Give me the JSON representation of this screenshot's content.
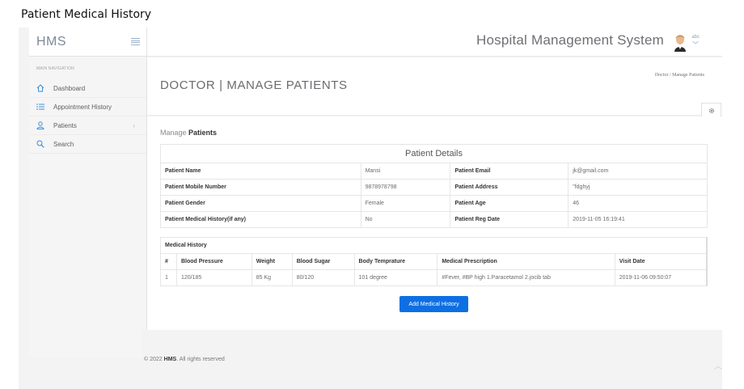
{
  "caption": "Patient Medical History",
  "brand": "HMS",
  "header": {
    "system_title": "Hospital Management System",
    "user_name": "abc",
    "user_caret": "﹀"
  },
  "nav": {
    "heading": "MAIN NAVIGATION",
    "items": [
      {
        "label": "Dashboard",
        "icon": "home-icon"
      },
      {
        "label": "Appointment History",
        "icon": "list-icon"
      },
      {
        "label": "Patients",
        "icon": "user-icon",
        "caret": "‹"
      },
      {
        "label": "Search",
        "icon": "search-icon"
      }
    ]
  },
  "page": {
    "title": "DOCTOR | MANAGE PATIENTS",
    "breadcrumb": "Doctor   /  Manage Patients",
    "manage_prefix": "Manage",
    "manage_bold": "Patients"
  },
  "details": {
    "caption": "Patient Details",
    "rows": [
      {
        "l1": "Patient Name",
        "v1": "Mansi",
        "l2": "Patient Email",
        "v2": "jk@gmail.com"
      },
      {
        "l1": "Patient Mobile Number",
        "v1": "9878978798",
        "l2": "Patient Address",
        "v2": "\"fdghyj"
      },
      {
        "l1": "Patient Gender",
        "v1": "Female",
        "l2": "Patient Age",
        "v2": "46"
      },
      {
        "l1": "Patient Medical History(if any)",
        "v1": "No",
        "l2": "Patient Reg Date",
        "v2": "2019-11-05 16:19:41"
      }
    ]
  },
  "history": {
    "caption": "Medical History",
    "columns": [
      "#",
      "Blood Pressure",
      "Weight",
      "Blood Sugar",
      "Body Temprature",
      "Medical Prescription",
      "Visit Date"
    ],
    "rows": [
      [
        "1",
        "120/185",
        "85 Kg",
        "80/120",
        "101 degree",
        "#Fever, #BP high 1.Paracetamol 2.jocib tab",
        "2019-11-06 09:50:07"
      ]
    ]
  },
  "add_button": "Add Medical History",
  "footer": {
    "prefix": "© 2022",
    "brand": "HMS",
    "suffix": ". All rights reserved",
    "scroll_icon": "︿"
  },
  "colors": {
    "accent": "#0d6fe3",
    "icon": "#3a8fd6"
  }
}
